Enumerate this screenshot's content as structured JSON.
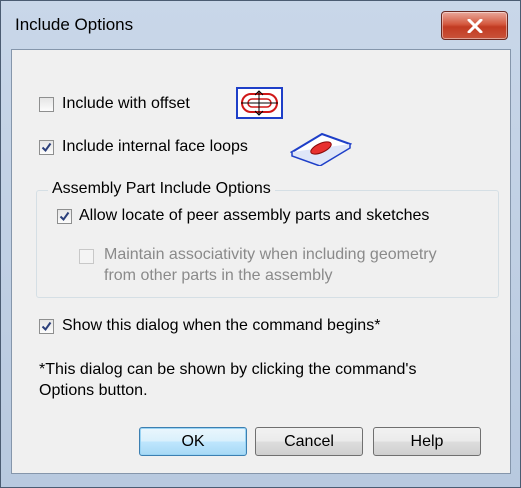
{
  "window": {
    "title": "Include Options"
  },
  "options": {
    "include_offset": {
      "label": "Include with offset",
      "checked": false
    },
    "internal_loops": {
      "label": "Include internal face loops",
      "checked": true
    }
  },
  "group": {
    "title": "Assembly Part Include Options",
    "allow_locate": {
      "label": "Allow locate of peer assembly parts and sketches",
      "checked": true
    },
    "maintain_assoc": {
      "label_line1": "Maintain associativity when including geometry",
      "label_line2": "from other parts in the assembly",
      "checked": false,
      "enabled": false
    }
  },
  "show_dialog": {
    "label": "Show this dialog when the command begins*",
    "checked": true
  },
  "note": {
    "line1": "*This dialog can be shown by clicking the command's",
    "line2": "Options button."
  },
  "buttons": {
    "ok": "OK",
    "cancel": "Cancel",
    "help": "Help"
  },
  "colors": {
    "accent": "#1e3fc8",
    "offset_icon_red": "#d01818",
    "check_mark": "#2b3f7a"
  }
}
